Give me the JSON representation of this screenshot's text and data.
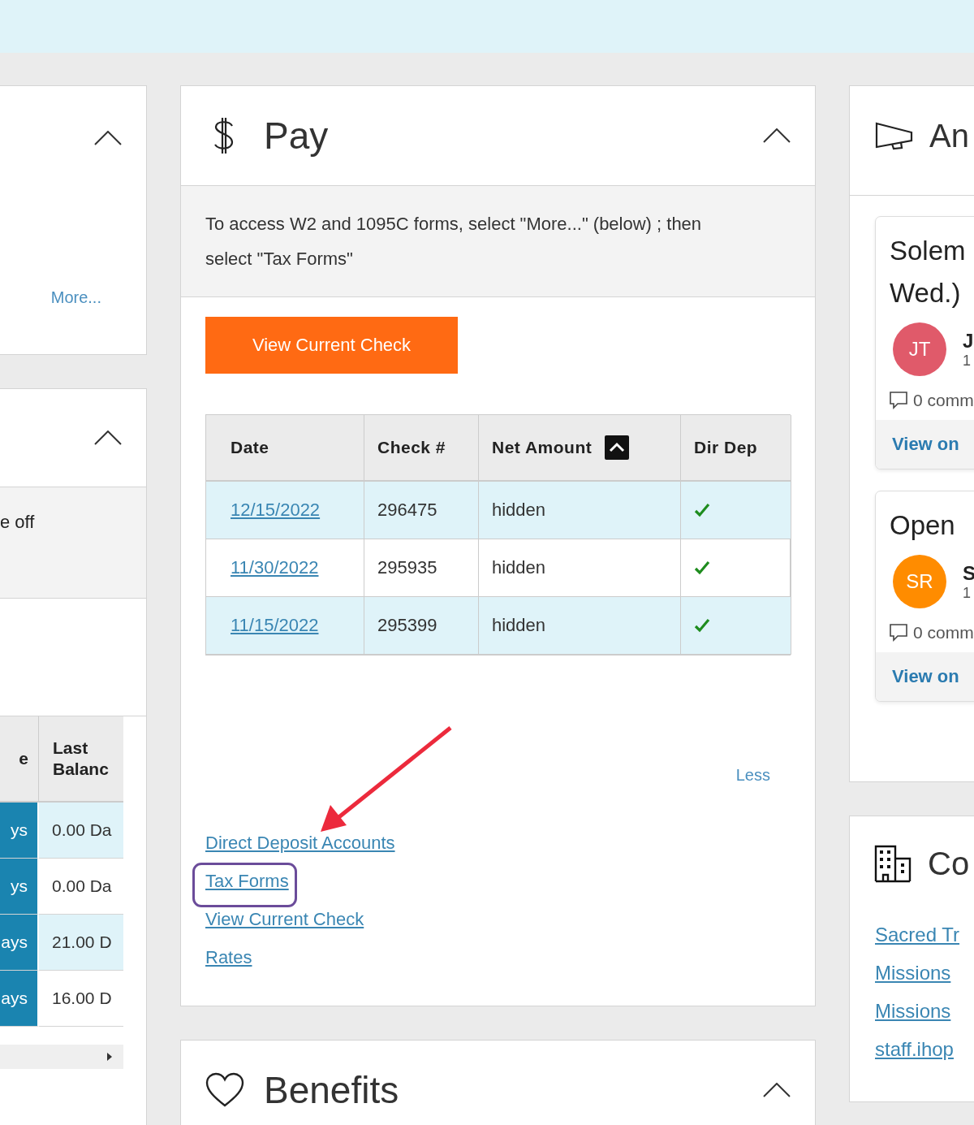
{
  "left_column": {
    "cards": [
      {
        "expanded": true,
        "more_link": "More..."
      },
      {
        "expanded": true,
        "notice": "e off",
        "table": {
          "columns": [
            "e",
            "Last Balanc"
          ],
          "rows": [
            {
              "cells": [
                "ys",
                "0.00 Da"
              ]
            },
            {
              "cells": [
                "ys",
                "0.00 Da"
              ]
            },
            {
              "cells": [
                "ays",
                "21.00 D"
              ]
            },
            {
              "cells": [
                "ays",
                "16.00 D"
              ]
            }
          ]
        }
      }
    ]
  },
  "pay": {
    "title": "Pay",
    "expanded": true,
    "notice": "To access W2 and 1095C forms, select \"More...\" (below) ; then select \"Tax Forms\"",
    "button": "View Current Check",
    "table": {
      "columns": [
        {
          "label": "Date",
          "sorted": false
        },
        {
          "label": "Check #",
          "sorted": false
        },
        {
          "label": "Net Amount",
          "sorted": true
        },
        {
          "label": "Dir Dep",
          "sorted": false
        }
      ],
      "rows": [
        {
          "date": "12/15/2022",
          "check": "296475",
          "net_amount": "hidden",
          "direct_deposit": true
        },
        {
          "date": "11/30/2022",
          "check": "295935",
          "net_amount": "hidden",
          "direct_deposit": true
        },
        {
          "date": "11/15/2022",
          "check": "295399",
          "net_amount": "hidden",
          "direct_deposit": true
        }
      ]
    },
    "less_link": "Less",
    "links": [
      {
        "label": "Direct Deposit Accounts",
        "highlighted": false
      },
      {
        "label": "Tax Forms",
        "highlighted": true
      },
      {
        "label": "View Current Check",
        "highlighted": false
      },
      {
        "label": "Rates",
        "highlighted": false
      }
    ]
  },
  "benefits": {
    "title": "Benefits",
    "expanded": true
  },
  "announcements": {
    "title": "An",
    "posts": [
      {
        "title_lines": [
          "Solem",
          "Wed.)"
        ],
        "initials": "JT",
        "color": "#e05a6a",
        "author": "J",
        "date": "1",
        "comments": "0 comm",
        "footer_link": "View on"
      },
      {
        "title_lines": [
          "Open"
        ],
        "initials": "SR",
        "color": "#ff8c00",
        "author": "S",
        "date": "1",
        "comments": "0 comm",
        "footer_link": "View on"
      }
    ]
  },
  "company": {
    "title": "Co",
    "links": [
      "Sacred Tr",
      "Missions",
      "Missions",
      "staff.ihop"
    ]
  }
}
